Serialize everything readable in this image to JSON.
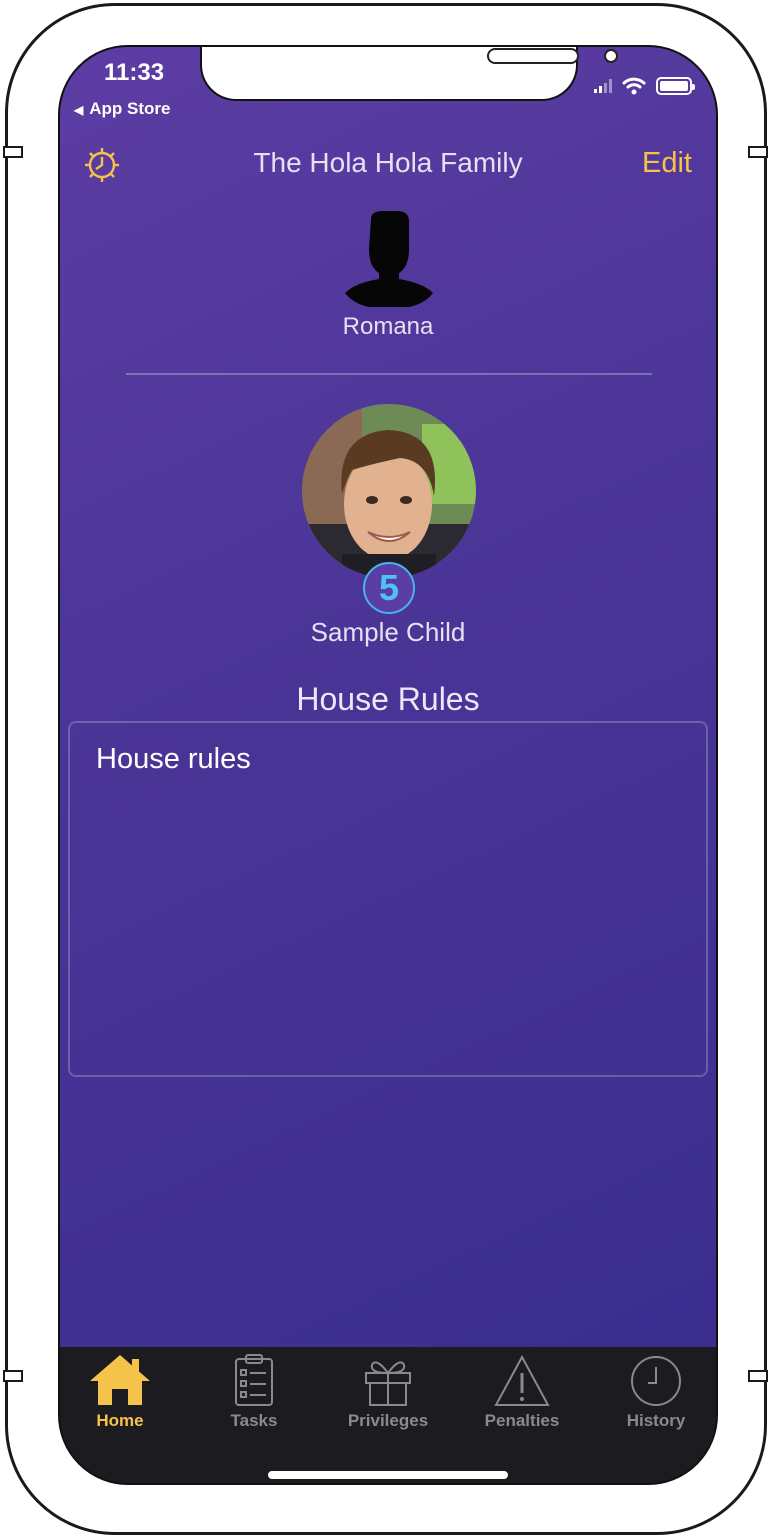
{
  "status_bar": {
    "time": "11:33",
    "back_app": "App Store"
  },
  "nav": {
    "title": "The Hola Hola Family",
    "edit_label": "Edit"
  },
  "parent": {
    "name": "Romana"
  },
  "child": {
    "name": "Sample Child",
    "badge_count": "5"
  },
  "house_rules": {
    "title": "House Rules",
    "text": "House rules"
  },
  "tabs": [
    {
      "label": "Home",
      "icon": "house-icon",
      "active": true
    },
    {
      "label": "Tasks",
      "icon": "clipboard-icon",
      "active": false
    },
    {
      "label": "Privileges",
      "icon": "gift-icon",
      "active": false
    },
    {
      "label": "Penalties",
      "icon": "warning-icon",
      "active": false
    },
    {
      "label": "History",
      "icon": "clock-icon",
      "active": false
    }
  ],
  "colors": {
    "accent": "#f5c24a",
    "background_top": "#5d3da3",
    "background_bottom": "#3b2e8f",
    "tabbar": "#1c1b1f",
    "badge": "#4fc2f5"
  }
}
